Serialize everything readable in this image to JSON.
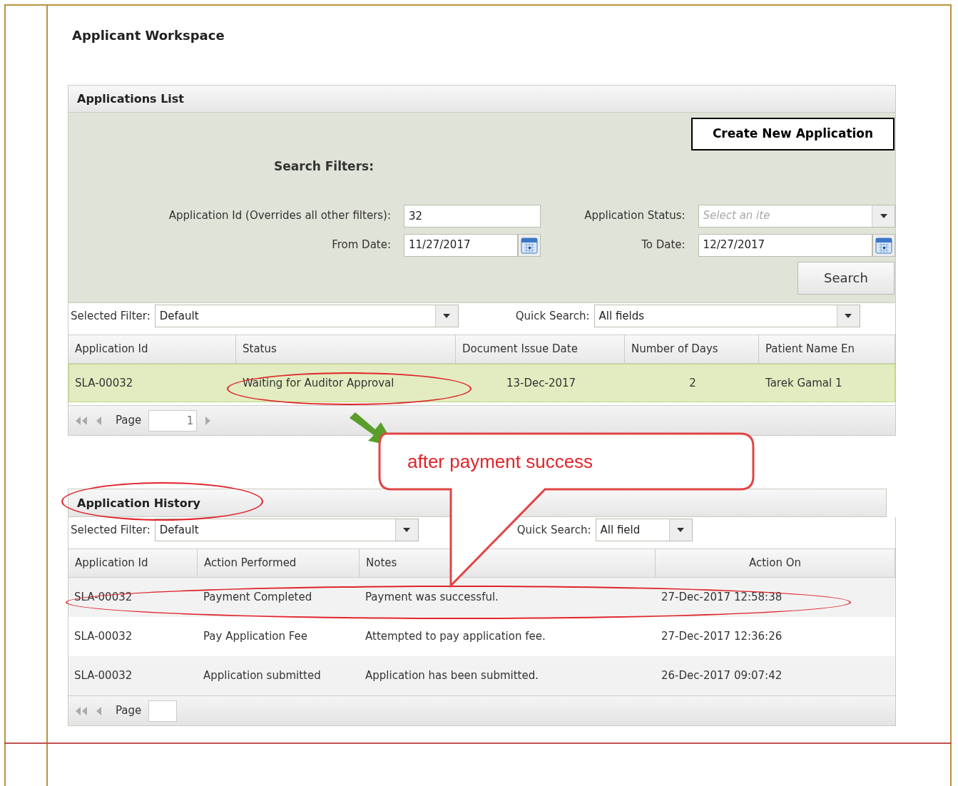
{
  "page_title": "Applicant Workspace",
  "applications_list": {
    "title": "Applications List",
    "create_button": "Create New Application",
    "filters_heading": "Search Filters:",
    "fields": [
      {
        "label": "Application Id (Overrides all other filters):",
        "value": "32",
        "kind": "text"
      },
      {
        "label": "Application Status:",
        "placeholder": "Select an ite",
        "kind": "dropdown"
      },
      {
        "label": "From Date:",
        "value": "11/27/2017",
        "kind": "date"
      },
      {
        "label": "To Date:",
        "value": "12/27/2017",
        "kind": "date"
      }
    ],
    "search_button": "Search",
    "selected_filter": {
      "label": "Selected Filter:",
      "value": "Default"
    },
    "quick_search": {
      "label": "Quick Search:",
      "value": "All fields"
    },
    "columns": [
      "Application Id",
      "Status",
      "Document Issue Date",
      "Number of Days",
      "Patient Name En"
    ],
    "rows": [
      {
        "cells": [
          "SLA-00032",
          "Waiting for Auditor Approval",
          "13-Dec-2017",
          "2",
          "Tarek Gamal 1"
        ],
        "selected": true
      }
    ],
    "pager": {
      "label": "Page",
      "value": "1"
    }
  },
  "application_history": {
    "title": "Application History",
    "selected_filter": {
      "label": "Selected Filter:",
      "value": "Default"
    },
    "quick_search": {
      "label": "Quick Search:",
      "value": "All field"
    },
    "columns": [
      "Application Id",
      "Action Performed",
      "Notes",
      "Action On"
    ],
    "rows": [
      {
        "cells": [
          "SLA-00032",
          "Payment Completed",
          "Payment was successful.",
          "27-Dec-2017 12:58:38"
        ]
      },
      {
        "cells": [
          "SLA-00032",
          "Pay Application Fee",
          "Attempted to pay application fee.",
          "27-Dec-2017 12:36:26"
        ]
      },
      {
        "cells": [
          "SLA-00032",
          "Application submitted",
          "Application has been submitted.",
          "26-Dec-2017 09:07:42"
        ]
      }
    ],
    "pager": {
      "label": "Page"
    }
  },
  "callout": {
    "text": "after payment success"
  }
}
